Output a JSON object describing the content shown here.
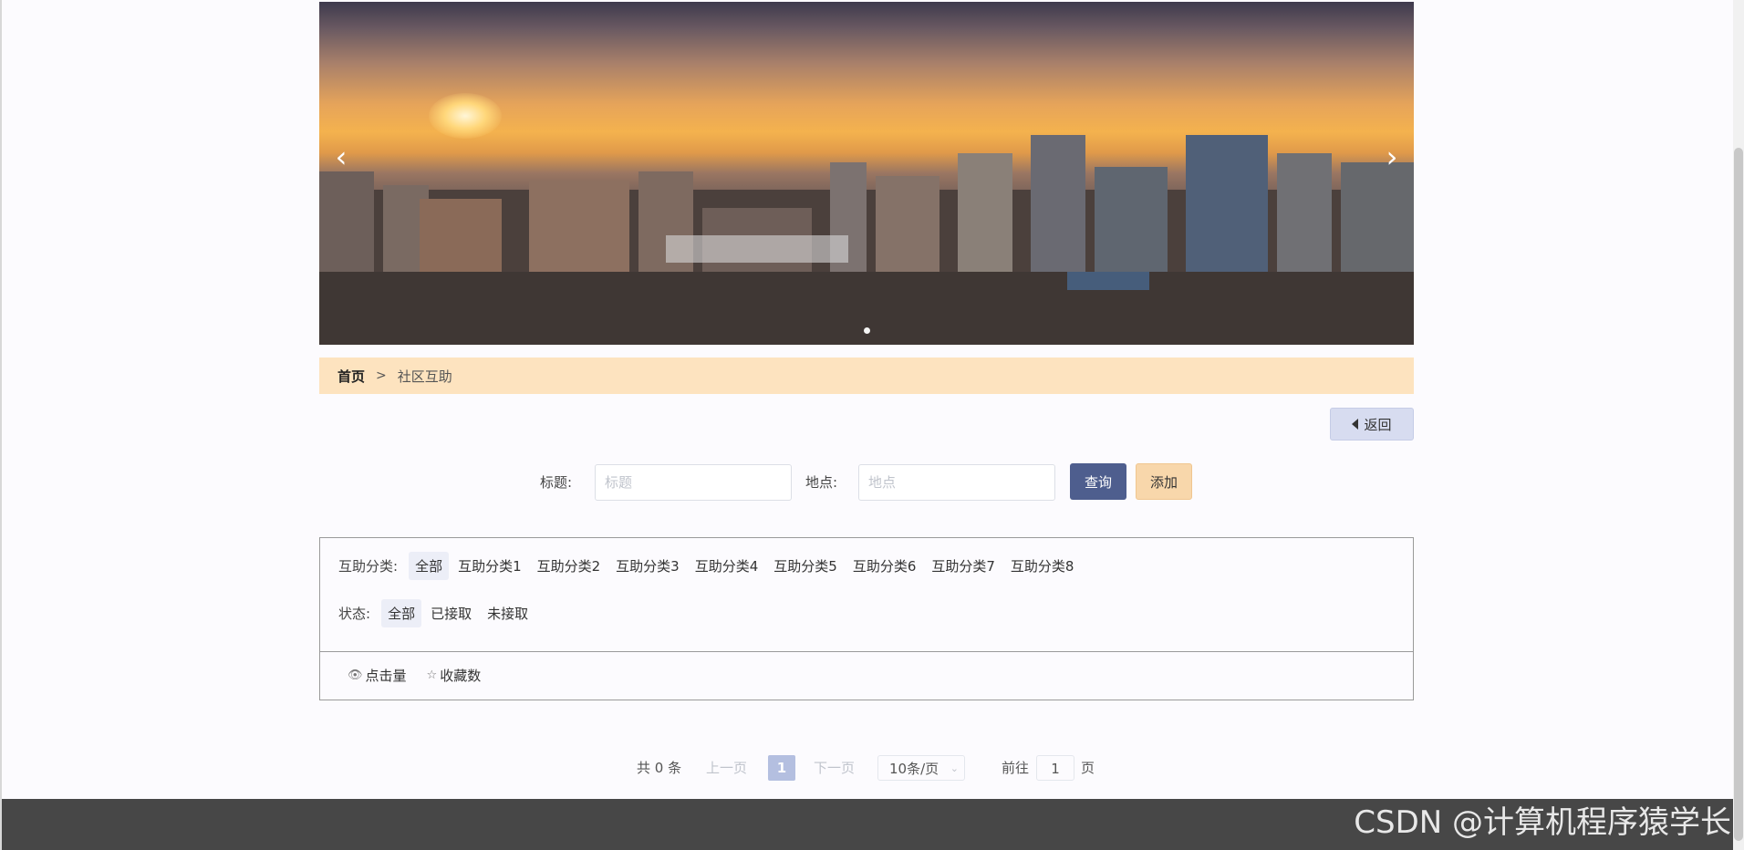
{
  "banner": {
    "prev_arrow": "‹",
    "next_arrow": "›",
    "dot_count": 1
  },
  "breadcrumb": {
    "home": "首页",
    "separator": ">",
    "current": "社区互助"
  },
  "back_button": {
    "label": "返回"
  },
  "search": {
    "title_label": "标题:",
    "title_placeholder": "标题",
    "location_label": "地点:",
    "location_placeholder": "地点",
    "query_button": "查询",
    "add_button": "添加"
  },
  "filters": {
    "category": {
      "label": "互助分类:",
      "options": [
        "全部",
        "互助分类1",
        "互助分类2",
        "互助分类3",
        "互助分类4",
        "互助分类5",
        "互助分类6",
        "互助分类7",
        "互助分类8"
      ],
      "selected": "全部"
    },
    "status": {
      "label": "状态:",
      "options": [
        "全部",
        "已接取",
        "未接取"
      ],
      "selected": "全部"
    }
  },
  "sort": {
    "clicks": {
      "icon": "eye-icon",
      "label": "点击量"
    },
    "favorites": {
      "icon": "star-icon",
      "label": "收藏数"
    }
  },
  "pagination": {
    "total": "共 0 条",
    "prev": "上一页",
    "current_page": "1",
    "next": "下一页",
    "page_size": "10条/页",
    "goto_label": "前往",
    "goto_value": "1",
    "goto_unit": "页"
  },
  "watermark": "CSDN @计算机程序猿学长",
  "colors": {
    "breadcrumb_bg": "#fde3bf",
    "primary_button": "#4e5e8e",
    "add_button": "#f8d7ab",
    "back_button": "#d7dcf0",
    "footer": "#474747",
    "page_active": "#b4bfe0"
  }
}
